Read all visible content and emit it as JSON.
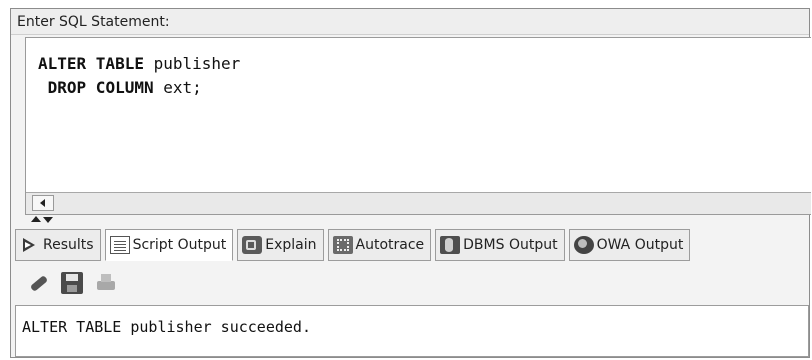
{
  "sql_panel": {
    "label": "Enter SQL Statement:",
    "lines": [
      {
        "keyword": "ALTER TABLE",
        "rest": " publisher",
        "indent": ""
      },
      {
        "keyword": "DROP COLUMN",
        "rest": " ext;",
        "indent": " "
      }
    ]
  },
  "tabs": [
    {
      "label": "Results",
      "icon": "play-icon",
      "active": false
    },
    {
      "label": "Script Output",
      "icon": "script-output-icon",
      "active": true
    },
    {
      "label": "Explain",
      "icon": "explain-icon",
      "active": false
    },
    {
      "label": "Autotrace",
      "icon": "autotrace-icon",
      "active": false
    },
    {
      "label": "DBMS Output",
      "icon": "dbms-output-icon",
      "active": false
    },
    {
      "label": "OWA Output",
      "icon": "owa-output-icon",
      "active": false
    }
  ],
  "toolbar": {
    "icons": [
      "eraser-icon",
      "save-icon",
      "print-icon"
    ]
  },
  "output": {
    "text": "ALTER TABLE publisher succeeded."
  }
}
